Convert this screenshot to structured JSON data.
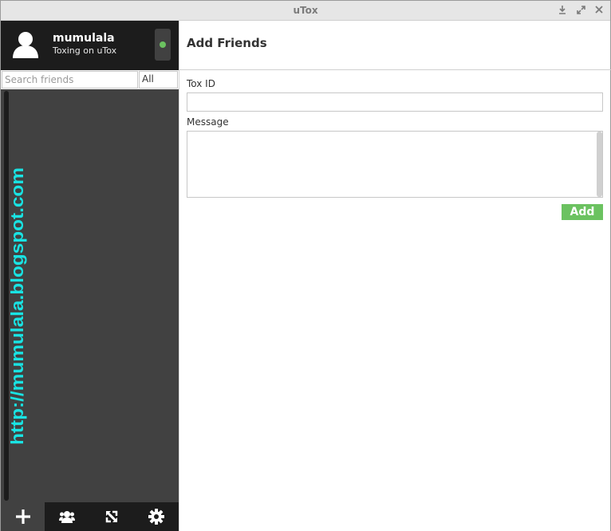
{
  "window": {
    "title": "uTox",
    "controls": [
      "minimize-icon",
      "maximize-icon",
      "close-icon"
    ]
  },
  "user": {
    "name": "mumulala",
    "status_message": "Toxing on uTox",
    "status_color": "#6bc260",
    "avatar_icon": "user-silhouette-icon"
  },
  "search": {
    "placeholder": "Search friends",
    "value": "",
    "filter_label": "All"
  },
  "watermark": {
    "text": "http://mumulala.blogspot.com",
    "color": "#19e3e3"
  },
  "bottom_bar": {
    "icons": [
      "plus-icon",
      "group-icon",
      "transfer-icon",
      "gear-icon"
    ]
  },
  "main": {
    "title": "Add Friends",
    "toxid_label": "Tox ID",
    "toxid_value": "",
    "message_label": "Message",
    "message_value": "",
    "add_label": "Add"
  },
  "colors": {
    "sidebar_dark": "#1c1c1c",
    "sidebar": "#414141",
    "accent_green": "#6bc260"
  }
}
